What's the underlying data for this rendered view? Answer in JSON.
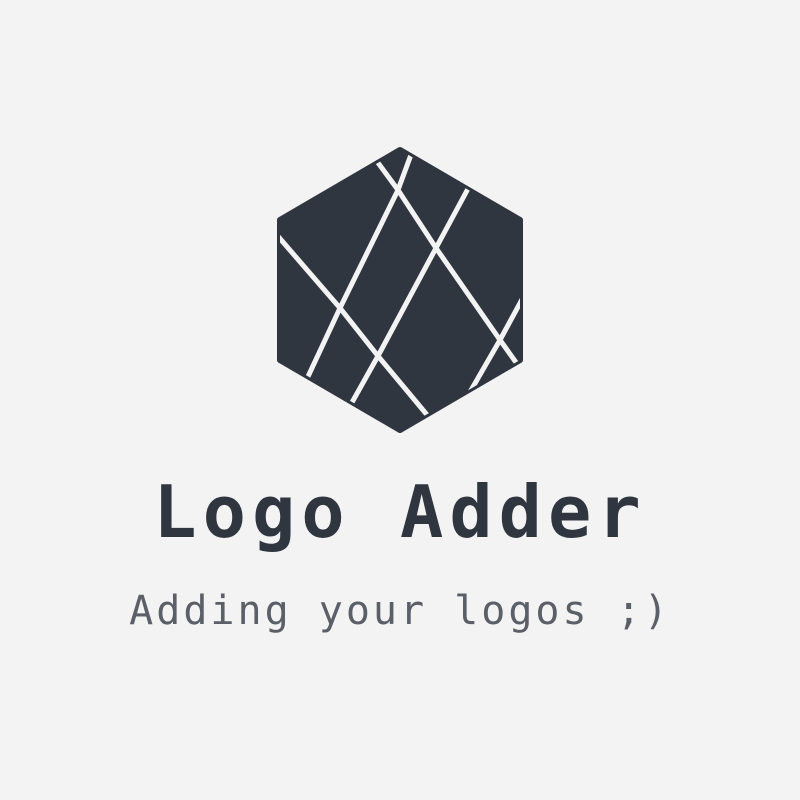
{
  "brand": {
    "name": "Logo Adder",
    "tagline": "Adding your logos ;)",
    "logo_icon": "faceted-hexagon-icon"
  },
  "colors": {
    "background": "#f3f3f3",
    "logo_fill": "#2f3640",
    "title": "#2f3640",
    "tagline": "#5b6068"
  }
}
